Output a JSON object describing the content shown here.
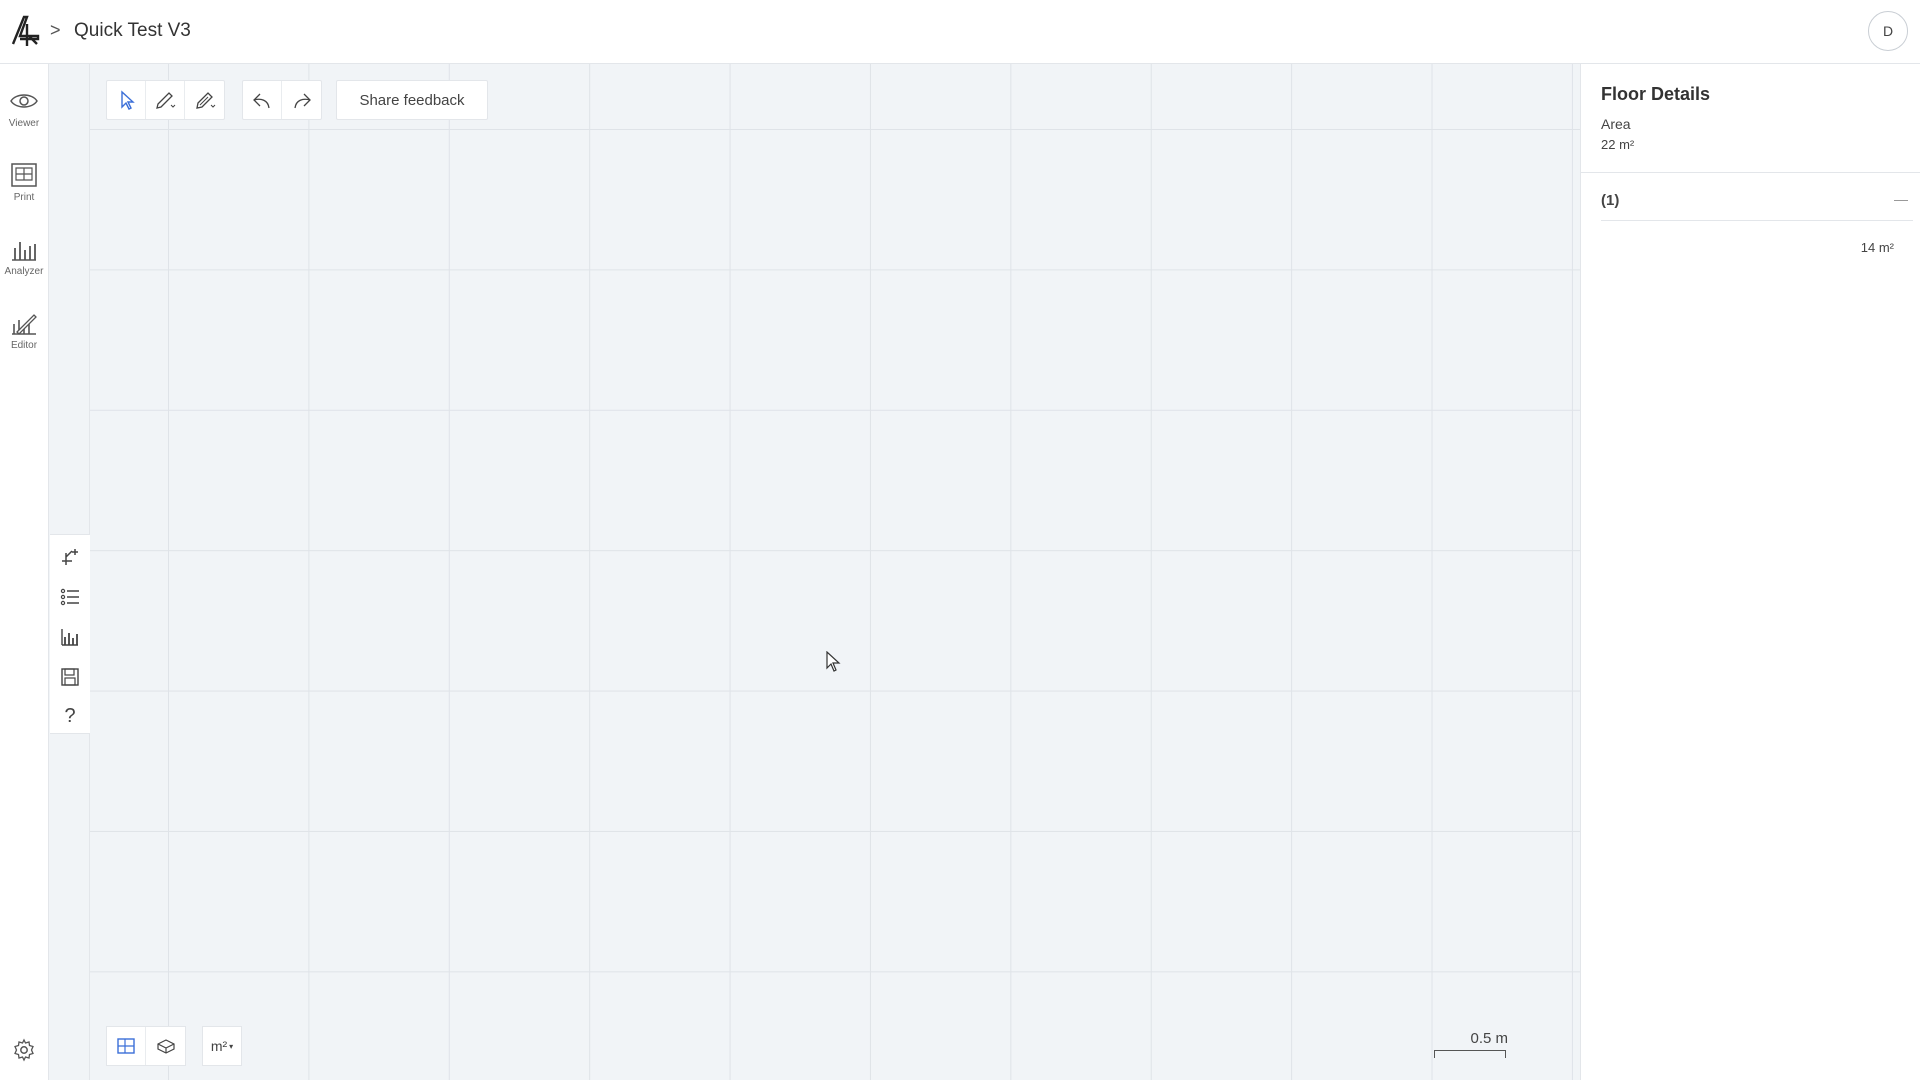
{
  "header": {
    "breadcrumb_separator": ">",
    "project_title": "Quick Test V3",
    "avatar_initial": "D"
  },
  "leftnav": {
    "items": [
      {
        "label": "Viewer",
        "icon": "eye-icon"
      },
      {
        "label": "Print",
        "icon": "print-icon"
      },
      {
        "label": "Analyzer",
        "icon": "bar-chart-icon"
      },
      {
        "label": "Editor",
        "icon": "editor-icon"
      }
    ],
    "active": "Editor",
    "settings_icon": "gear-icon"
  },
  "toolstrip": {
    "icons": [
      "add-structure-icon",
      "list-icon",
      "chart-icon",
      "save-icon",
      "help-icon"
    ],
    "help_glyph": "?"
  },
  "toolbar": {
    "select_icon": "cursor-icon",
    "draw_icon": "pencil-dropdown-icon",
    "edit_icon": "pen-dropdown-icon",
    "undo_icon": "undo-icon",
    "redo_icon": "redo-icon",
    "feedback_label": "Share feedback"
  },
  "bottom_tools": {
    "view_2d_icon": "floorplan-icon",
    "view_3d_icon": "cube-icon",
    "unit_label": "m²"
  },
  "scale": {
    "label": "0.5 m"
  },
  "floor_details": {
    "title": "Floor Details",
    "area_label": "Area",
    "area_value": "22 m²",
    "items": [
      {
        "title": "(1)",
        "value": "14 m²"
      }
    ]
  },
  "colors": {
    "canvas_bg": "#f1f4f7",
    "grid_line": "#dfe3e8",
    "accent": "#3b6fd8"
  }
}
